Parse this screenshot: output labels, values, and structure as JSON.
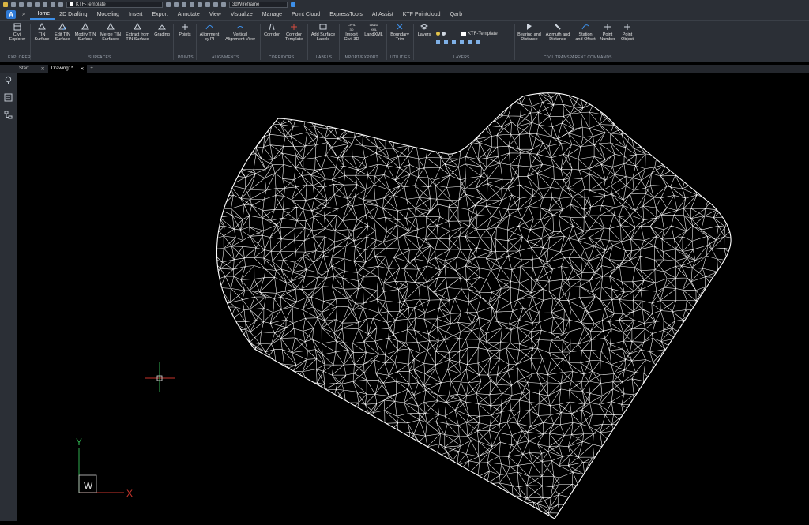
{
  "qat": {
    "template": "KTF-Template",
    "visual_style": "3dWireframe"
  },
  "menu": {
    "logo": "A",
    "tabs": [
      "Home",
      "2D Drafting",
      "Modeling",
      "Insert",
      "Export",
      "Annotate",
      "View",
      "Visualize",
      "Manage",
      "Point Cloud",
      "ExpressTools",
      "AI Assist",
      "KTF Pointcloud",
      "Qarb"
    ],
    "active_tab": "Home"
  },
  "ribbon": {
    "buttons": [
      {
        "l1": "Civil",
        "l2": "Explorer"
      },
      {
        "l1": "TIN",
        "l2": "Surface"
      },
      {
        "l1": "Edit TIN",
        "l2": "Surface"
      },
      {
        "l1": "Modify TIN",
        "l2": "Surface"
      },
      {
        "l1": "Merge TIN",
        "l2": "Surfaces"
      },
      {
        "l1": "Extract from",
        "l2": "TIN Surface"
      },
      {
        "l1": "Grading",
        "l2": ""
      },
      {
        "l1": "Points",
        "l2": ""
      },
      {
        "l1": "Alignment",
        "l2": "by PI"
      },
      {
        "l1": "Vertical",
        "l2": "Alignment View"
      },
      {
        "l1": "Corridor",
        "l2": ""
      },
      {
        "l1": "Corridor",
        "l2": "Template"
      },
      {
        "l1": "Add Surface",
        "l2": "Labels"
      },
      {
        "l1": "Import",
        "l2": "Civil 3D"
      },
      {
        "l1": "LandXML",
        "l2": ""
      },
      {
        "l1": "Boundary",
        "l2": "Trim"
      },
      {
        "l1": "Layers",
        "l2": ""
      },
      {
        "l1": "Bearing and",
        "l2": "Distance"
      },
      {
        "l1": "Azimuth and",
        "l2": "Distance"
      },
      {
        "l1": "Station",
        "l2": "and Offset"
      },
      {
        "l1": "Point",
        "l2": "Number"
      },
      {
        "l1": "Point",
        "l2": "Object"
      }
    ],
    "layer_name": "KTF-Template",
    "civil3d_small": "CIVIL 3D",
    "landxml_small": "LAND XML",
    "panels": [
      "EXPLORER",
      "SURFACES",
      "POINTS",
      "ALIGNMENTS",
      "CORRIDORS",
      "LABELS",
      "IMPORT/EXPORT",
      "UTILITIES",
      "LAYERS",
      "CIVIL TRANSPARENT COMMANDS"
    ]
  },
  "doc_tabs": {
    "start": "Start",
    "drawing": "Drawing1*",
    "add": "+"
  },
  "ucs": {
    "x": "X",
    "y": "Y",
    "w": "W"
  },
  "colors": {
    "accent": "#3d8fe8",
    "ucs_x": "#c8352c",
    "ucs_y": "#2fae4f",
    "mesh": "#ffffff"
  }
}
